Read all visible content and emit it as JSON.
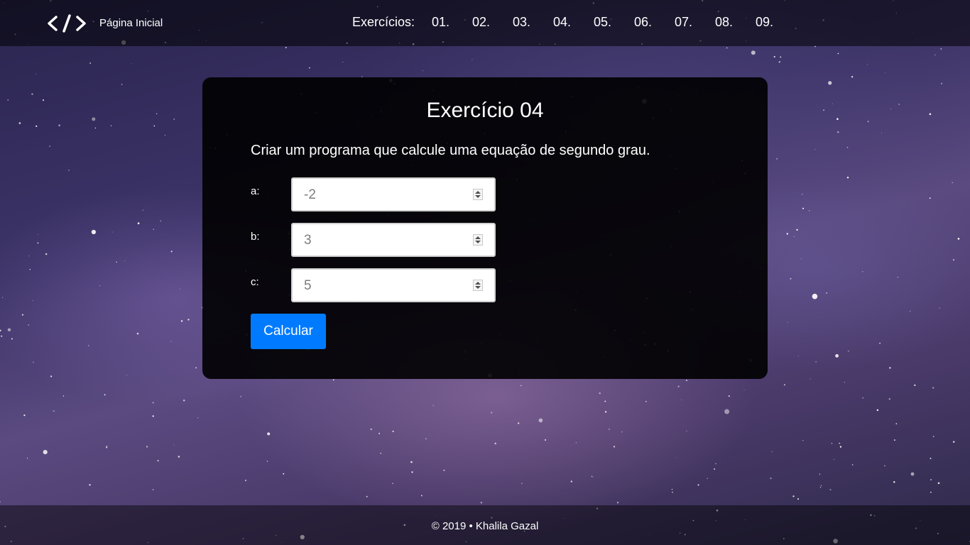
{
  "navbar": {
    "logo_icon": "code-brackets-icon",
    "home_label": "Página Inicial",
    "exercises_label": "Exercícios:",
    "exercise_links": [
      "01.",
      "02.",
      "03.",
      "04.",
      "05.",
      "06.",
      "07.",
      "08.",
      "09."
    ]
  },
  "card": {
    "title": "Exercício 04",
    "description": "Criar um programa que calcule uma equação de segundo grau.",
    "fields": [
      {
        "label": "a:",
        "value": "-2"
      },
      {
        "label": "b:",
        "value": "3"
      },
      {
        "label": "c:",
        "value": "5"
      }
    ],
    "button_label": "Calcular"
  },
  "footer": {
    "text": "© 2019 • Khalila Gazal"
  },
  "colors": {
    "button": "#007bff",
    "card_background": "#000000",
    "input_text": "#7d7d7d"
  }
}
